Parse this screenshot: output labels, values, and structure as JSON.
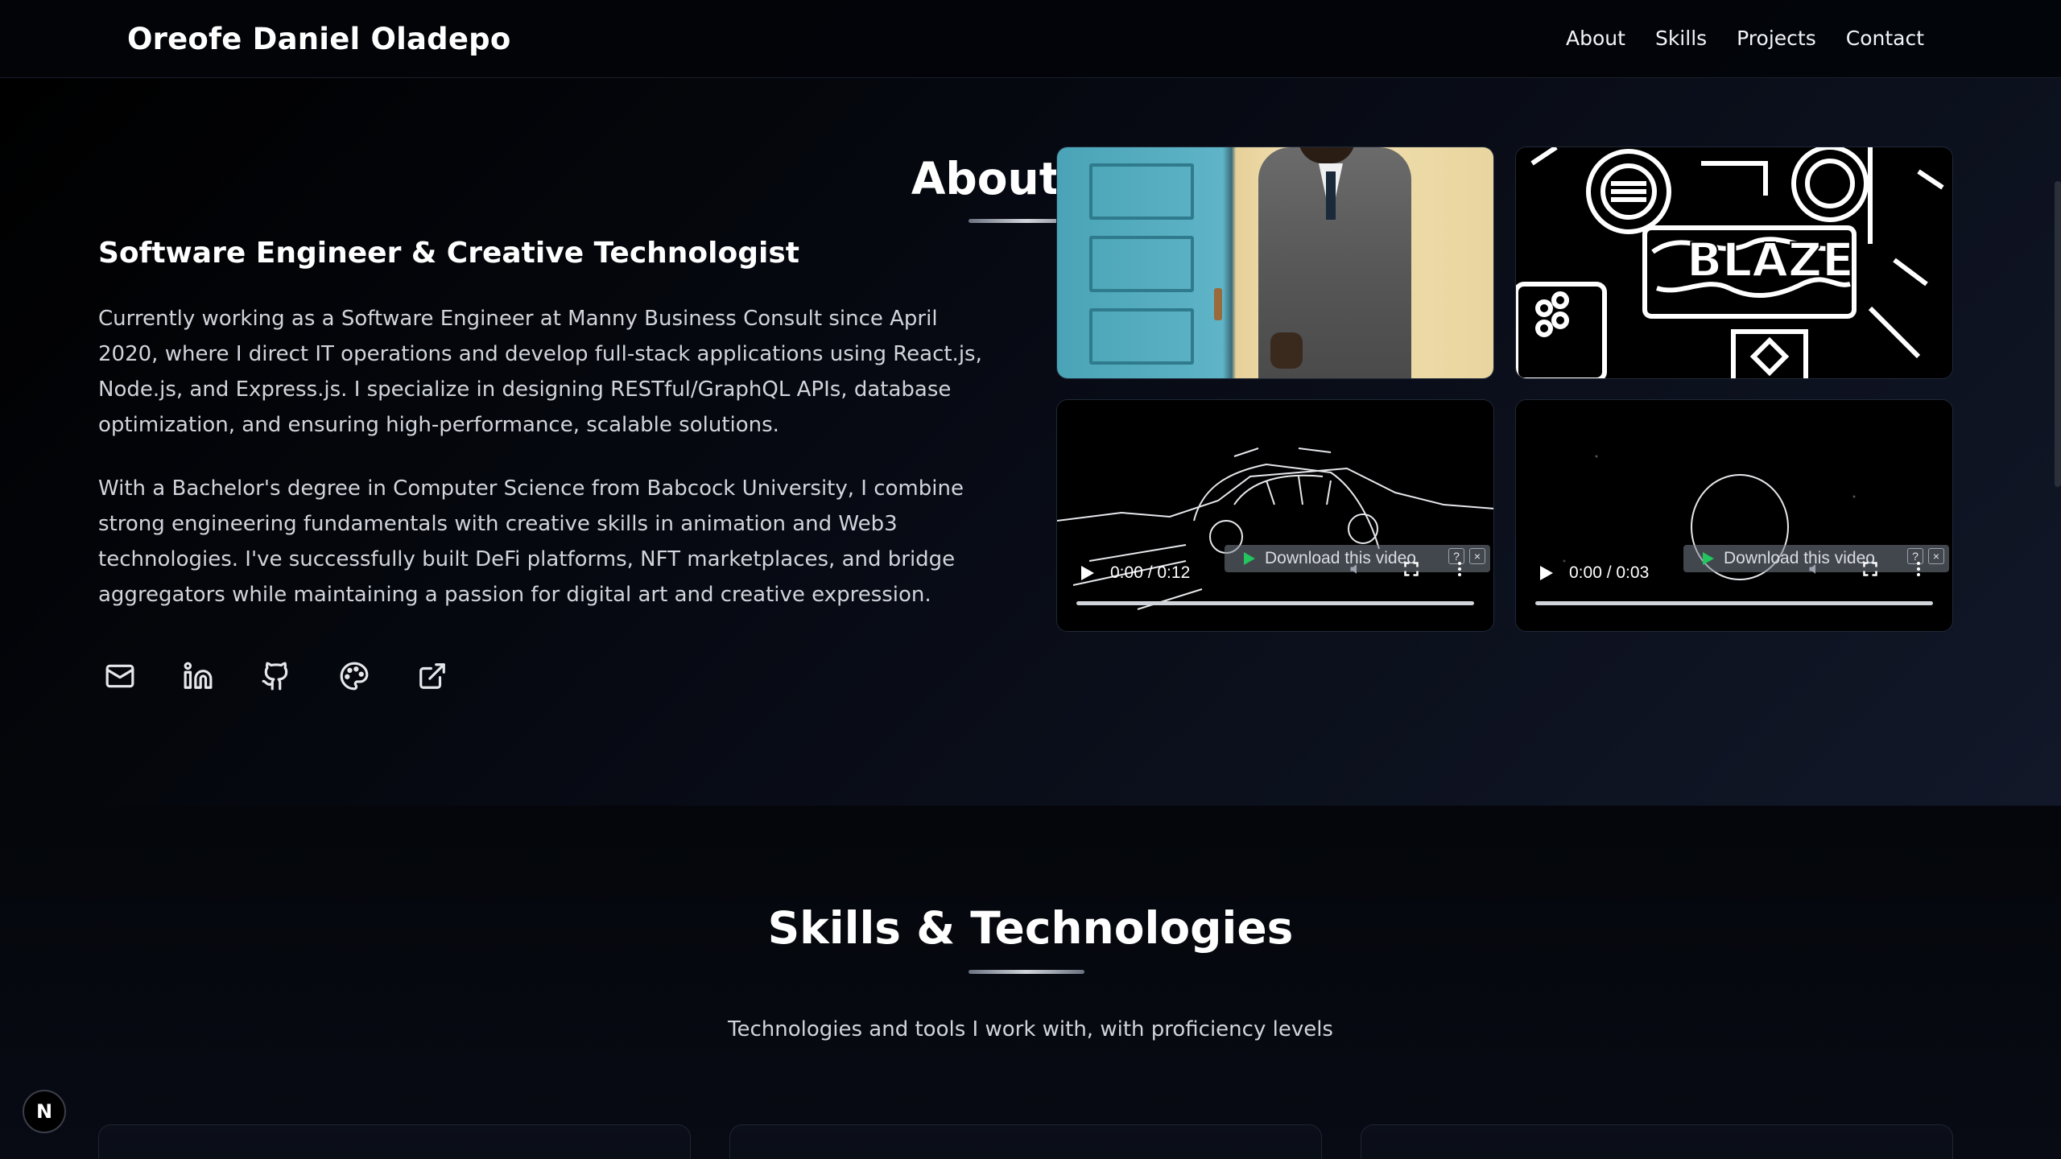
{
  "navbar": {
    "brand": "Oreofe Daniel Oladepo",
    "links": [
      "About",
      "Skills",
      "Projects",
      "Contact"
    ]
  },
  "about": {
    "title": "About Me",
    "subtitle": "Software Engineer & Creative Technologist",
    "paragraph1": "Currently working as a Software Engineer at Manny Business Consult since April 2020, where I direct IT operations and develop full-stack applications using React.js, Node.js, and Express.js. I specialize in designing RESTful/GraphQL APIs, database optimization, and ensuring high-performance, scalable solutions.",
    "paragraph2": "With a Bachelor's degree in Computer Science from Babcock University, I combine strong engineering fundamentals with creative skills in animation and Web3 technologies. I've successfully built DeFi platforms, NFT marketplaces, and bridge aggregators while maintaining a passion for digital art and creative expression.",
    "socials": [
      "mail-icon",
      "linkedin-icon",
      "github-icon",
      "palette-icon",
      "external-link-icon"
    ]
  },
  "media": {
    "video1": {
      "time": "0:00 / 0:12",
      "download_label": "Download this video",
      "help": "?",
      "close": "×"
    },
    "video2": {
      "time": "0:00 / 0:03",
      "download_label": "Download this video",
      "help": "?",
      "close": "×"
    }
  },
  "skills": {
    "title": "Skills & Technologies",
    "description": "Technologies and tools I work with, with proficiency levels"
  },
  "badge": {
    "letter": "N"
  },
  "colors": {
    "background": "#05070c",
    "text": "#e5e7eb",
    "accent_underline": "#d1d5db"
  }
}
